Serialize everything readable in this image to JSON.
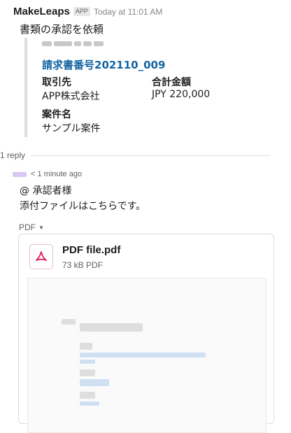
{
  "message": {
    "sender": "MakeLeaps",
    "badge": "APP",
    "time": "Today at 11:01 AM",
    "text": "書類の承認を依頼"
  },
  "attachment": {
    "invoice_link": "請求書番号202110_009",
    "fields": [
      {
        "label": "取引先",
        "value": "APP株式会社"
      },
      {
        "label": "合計金額",
        "value": "JPY 220,000"
      },
      {
        "label": "案件名",
        "value": "サンプル案件"
      }
    ]
  },
  "thread": {
    "reply_count": "1 reply"
  },
  "reply": {
    "time": "< 1 minute ago",
    "line1": "@ 承認者様",
    "line2": "添付ファイルはこちらです。",
    "toggle_label": "PDF"
  },
  "file": {
    "name": "PDF file.pdf",
    "meta": "73 kB PDF",
    "icon": "pdf-icon"
  },
  "colors": {
    "link": "#1264a3",
    "pdf_red": "#e01e5a"
  }
}
